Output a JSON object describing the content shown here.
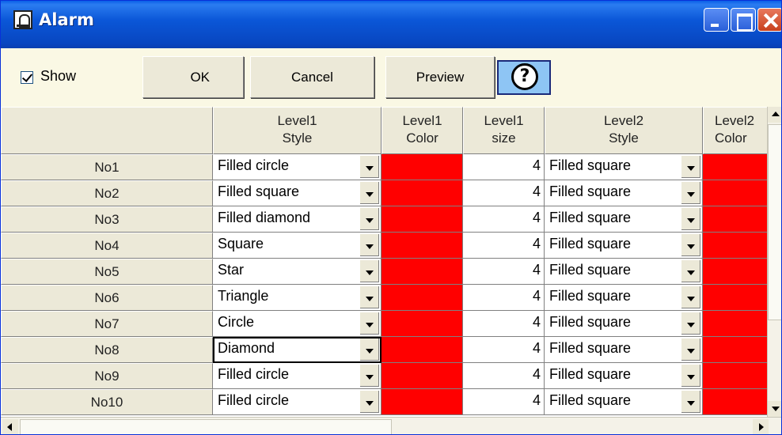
{
  "window": {
    "title": "Alarm",
    "icon": "alarm-clock-icon"
  },
  "toolbar": {
    "show_label": "Show",
    "show_checked": true,
    "ok_label": "OK",
    "cancel_label": "Cancel",
    "preview_label": "Preview",
    "help_symbol": "?"
  },
  "grid": {
    "columns": [
      {
        "label": "Level1\nStyle"
      },
      {
        "label": "Level1\nColor"
      },
      {
        "label": "Level1\nsize"
      },
      {
        "label": "Level2\nStyle"
      },
      {
        "label": "Level2\nColor"
      }
    ],
    "rows": [
      {
        "name": "No1",
        "style1": "Filled circle",
        "color1": "#ff0000",
        "size1": "4",
        "style2": "Filled square",
        "color2": "#ff0000"
      },
      {
        "name": "No2",
        "style1": "Filled square",
        "color1": "#ff0000",
        "size1": "4",
        "style2": "Filled square",
        "color2": "#ff0000"
      },
      {
        "name": "No3",
        "style1": "Filled diamond",
        "color1": "#ff0000",
        "size1": "4",
        "style2": "Filled square",
        "color2": "#ff0000"
      },
      {
        "name": "No4",
        "style1": "Square",
        "color1": "#ff0000",
        "size1": "4",
        "style2": "Filled square",
        "color2": "#ff0000"
      },
      {
        "name": "No5",
        "style1": "Star",
        "color1": "#ff0000",
        "size1": "4",
        "style2": "Filled square",
        "color2": "#ff0000"
      },
      {
        "name": "No6",
        "style1": "Triangle",
        "color1": "#ff0000",
        "size1": "4",
        "style2": "Filled square",
        "color2": "#ff0000"
      },
      {
        "name": "No7",
        "style1": "Circle",
        "color1": "#ff0000",
        "size1": "4",
        "style2": "Filled square",
        "color2": "#ff0000"
      },
      {
        "name": "No8",
        "style1": "Diamond",
        "color1": "#ff0000",
        "size1": "4",
        "style2": "Filled square",
        "color2": "#ff0000"
      },
      {
        "name": "No9",
        "style1": "Filled circle",
        "color1": "#ff0000",
        "size1": "4",
        "style2": "Filled square",
        "color2": "#ff0000"
      },
      {
        "name": "No10",
        "style1": "Filled circle",
        "color1": "#ff0000",
        "size1": "4",
        "style2": "Filled square",
        "color2": "#ff0000"
      }
    ]
  }
}
